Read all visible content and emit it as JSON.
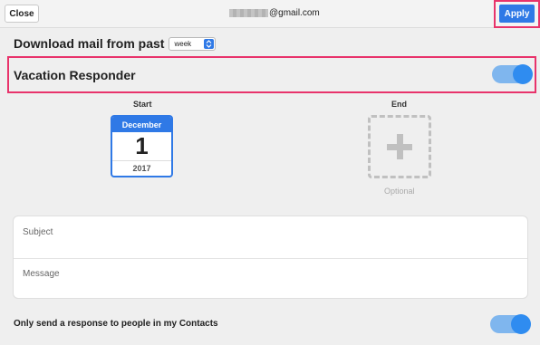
{
  "topbar": {
    "close_label": "Close",
    "account_suffix": "@gmail.com",
    "apply_label": "Apply"
  },
  "download": {
    "label": "Download mail from past",
    "selected_period": "week"
  },
  "vacation": {
    "label": "Vacation Responder",
    "enabled": true
  },
  "start": {
    "label": "Start",
    "month": "December",
    "day": "1",
    "year": "2017"
  },
  "end": {
    "label": "End",
    "optional_label": "Optional"
  },
  "message": {
    "subject_placeholder": "Subject",
    "message_placeholder": "Message"
  },
  "contacts": {
    "label": "Only send a response to people in my Contacts",
    "enabled": true
  },
  "colors": {
    "accent": "#2f79e6",
    "highlight": "#e8336b",
    "toggle_on": "#2f8cf0"
  }
}
